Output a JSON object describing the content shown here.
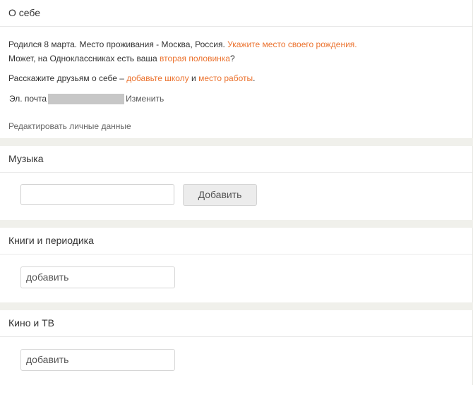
{
  "about": {
    "title": "О себе",
    "line1_text": "Родился 8 марта. Место проживания - Москва, Россия. ",
    "line1_link": "Укажите место своего рождения.",
    "line2_text": "Может, на Одноклассниках есть ваша ",
    "line2_link": "вторая половинка",
    "line2_suffix": "?",
    "line3_text": "Расскажите друзьям о себе – ",
    "line3_link1": "добавьте школу",
    "line3_and": " и ",
    "line3_link2": "место работы",
    "line3_suffix": ".",
    "email_label": "Эл. почта",
    "email_change": "Изменить",
    "edit_personal": "Редактировать личные данные"
  },
  "music": {
    "title": "Музыка",
    "input_value": "",
    "add_button": "Добавить"
  },
  "books": {
    "title": "Книги и периодика",
    "add_placeholder": "добавить"
  },
  "movies": {
    "title": "Кино и ТВ",
    "add_placeholder": "добавить"
  },
  "colors": {
    "link": "#eb722e",
    "divider": "#f0f0eb",
    "email_mask": "#c7c7c7"
  }
}
